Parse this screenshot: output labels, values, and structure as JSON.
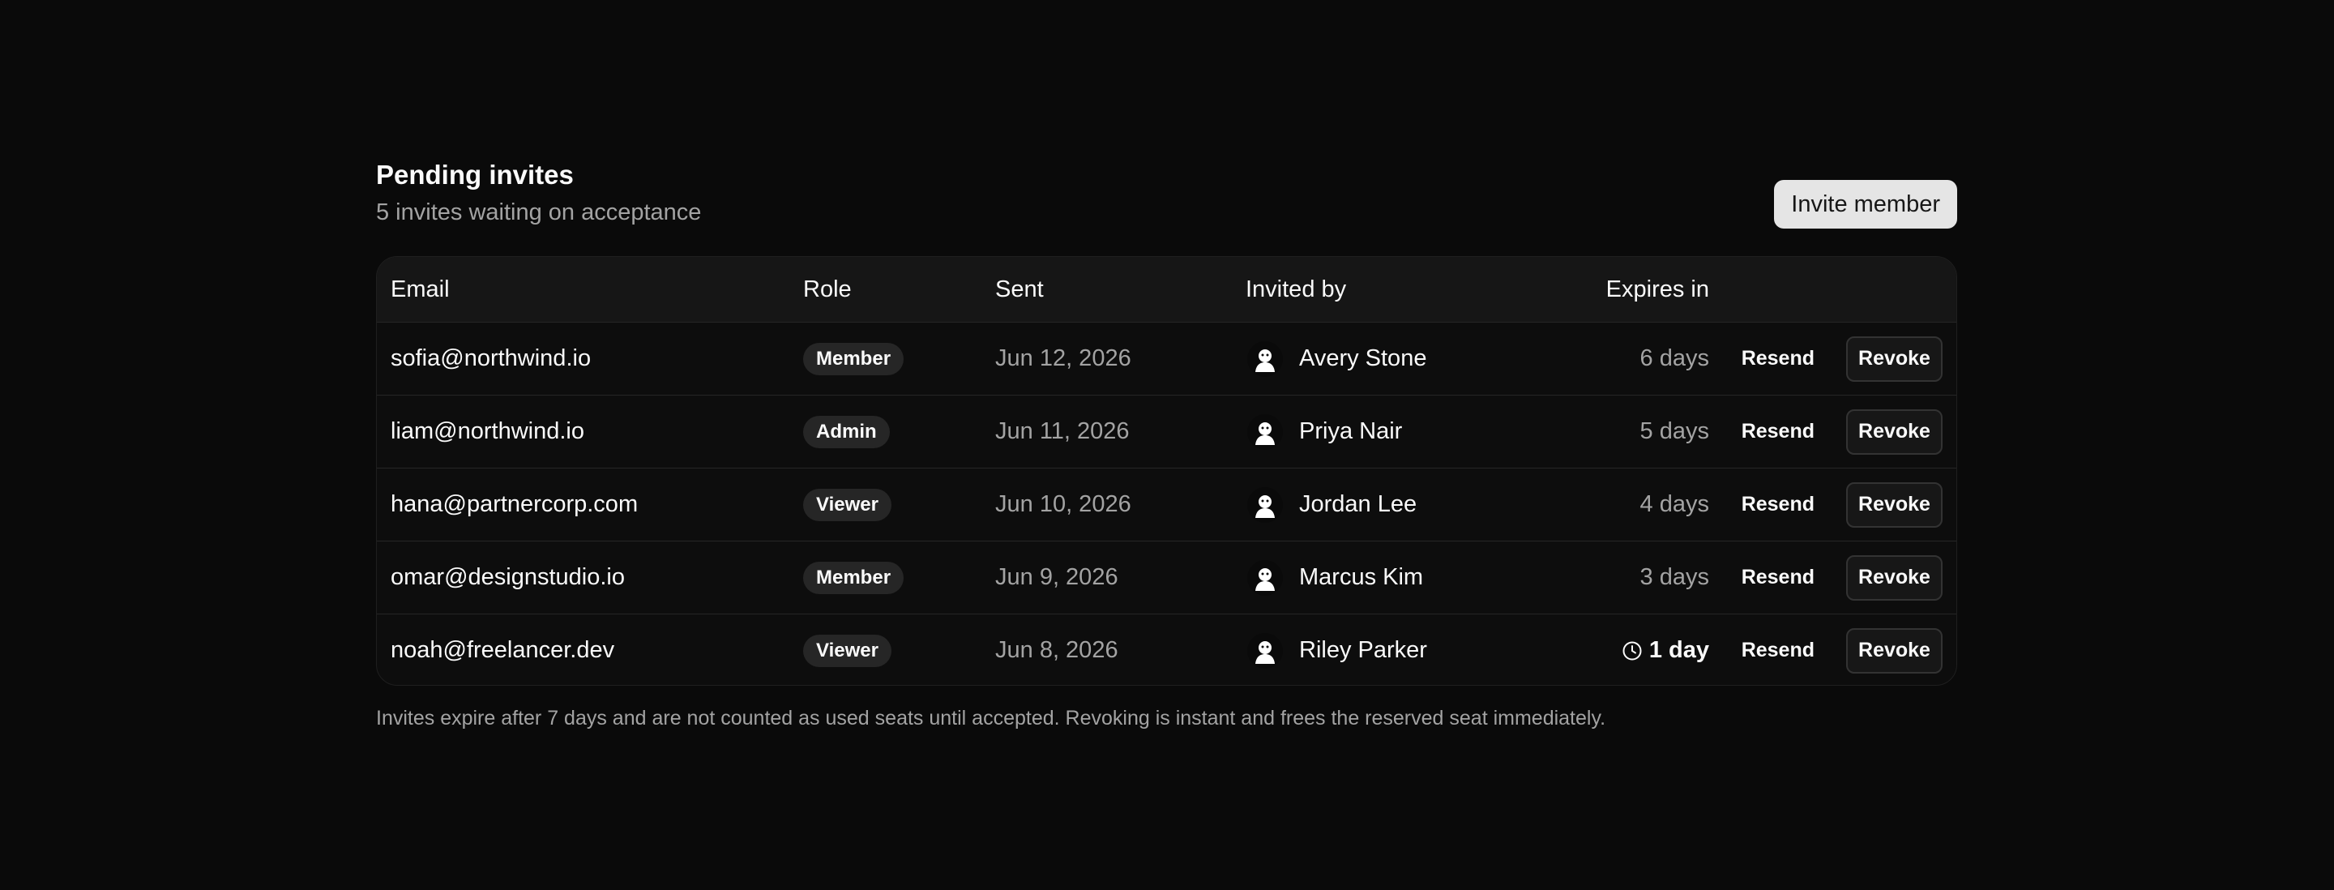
{
  "header": {
    "title": "Pending invites",
    "subtitle": "5 invites waiting on acceptance",
    "invite_button": "Invite member"
  },
  "table": {
    "columns": {
      "email": "Email",
      "role": "Role",
      "sent": "Sent",
      "invited_by": "Invited by",
      "expires": "Expires in"
    },
    "rows": [
      {
        "email": "sofia@northwind.io",
        "role": "Member",
        "sent": "Jun 12, 2026",
        "invited_by": "Avery Stone",
        "expires": "6 days",
        "resend": "Resend",
        "revoke": "Revoke"
      },
      {
        "email": "liam@northwind.io",
        "role": "Admin",
        "sent": "Jun 11, 2026",
        "invited_by": "Priya Nair",
        "expires": "5 days",
        "resend": "Resend",
        "revoke": "Revoke"
      },
      {
        "email": "hana@partnercorp.com",
        "role": "Viewer",
        "sent": "Jun 10, 2026",
        "invited_by": "Jordan Lee",
        "expires": "4 days",
        "resend": "Resend",
        "revoke": "Revoke"
      },
      {
        "email": "omar@designstudio.io",
        "role": "Member",
        "sent": "Jun 9, 2026",
        "invited_by": "Marcus Kim",
        "expires": "3 days",
        "resend": "Resend",
        "revoke": "Revoke"
      },
      {
        "email": "noah@freelancer.dev",
        "role": "Viewer",
        "sent": "Jun 8, 2026",
        "invited_by": "Riley Parker",
        "expires": "1 day",
        "resend": "Resend",
        "revoke": "Revoke"
      }
    ]
  },
  "footnote": "Invites expire after 7 days and are not counted as used seats until accepted. Revoking is instant and frees the reserved seat immediately.",
  "icons": {
    "avatar": "avatar-icon",
    "clock": "clock-icon"
  },
  "colors": {
    "background": "#0a0a0a",
    "header_row": "#161616",
    "badge": "#262626",
    "primary_button": "#e5e5e5",
    "muted_text": "#a3a3a3"
  }
}
